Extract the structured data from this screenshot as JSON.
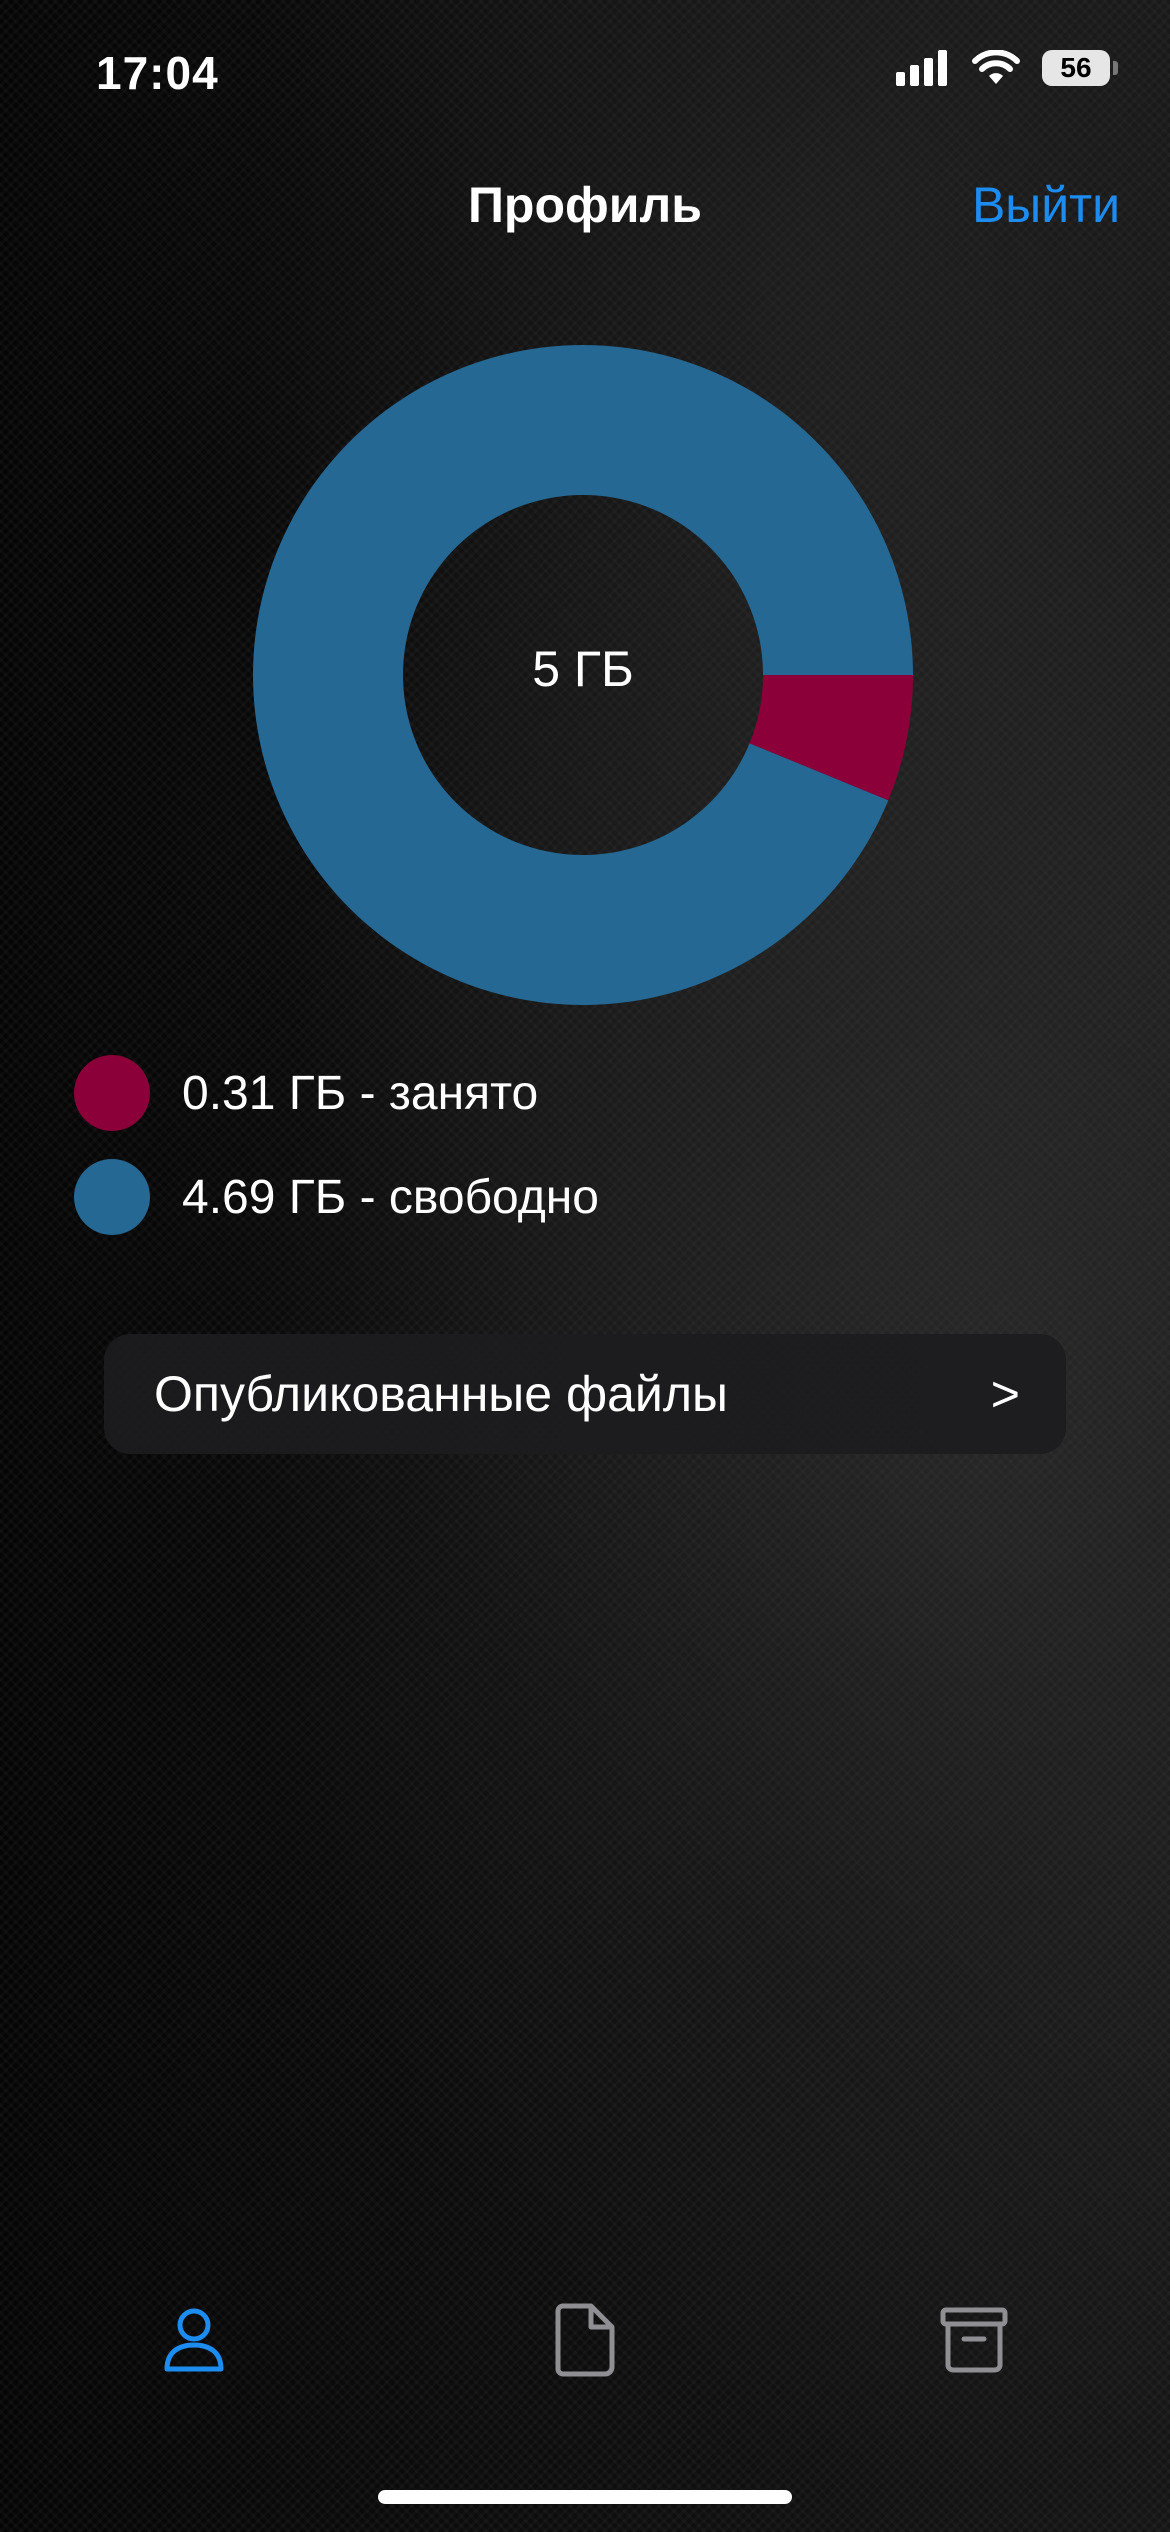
{
  "status_bar": {
    "time": "17:04",
    "battery": "56"
  },
  "nav": {
    "title": "Профиль",
    "logout_label": "Выйти"
  },
  "chart_data": {
    "type": "pie",
    "center_label": "5 ГБ",
    "slices": [
      {
        "label": "0.31 ГБ - занято",
        "value": 0.31,
        "color": "#8b0038"
      },
      {
        "label": "4.69 ГБ - свободно",
        "value": 4.69,
        "color": "#256893"
      }
    ]
  },
  "legend": {
    "items": [
      {
        "label": "0.31 ГБ - занято",
        "color": "#8b0038"
      },
      {
        "label": "4.69 ГБ - свободно",
        "color": "#256893"
      }
    ]
  },
  "published_files": {
    "label": "Опубликованные файлы",
    "chevron": ">"
  },
  "tab_bar": {
    "tabs": [
      {
        "icon": "person-icon",
        "active": true
      },
      {
        "icon": "document-icon",
        "active": false
      },
      {
        "icon": "archive-box-icon",
        "active": false
      }
    ],
    "active_color": "#1d8cf0",
    "inactive_color": "#8e8e93"
  }
}
